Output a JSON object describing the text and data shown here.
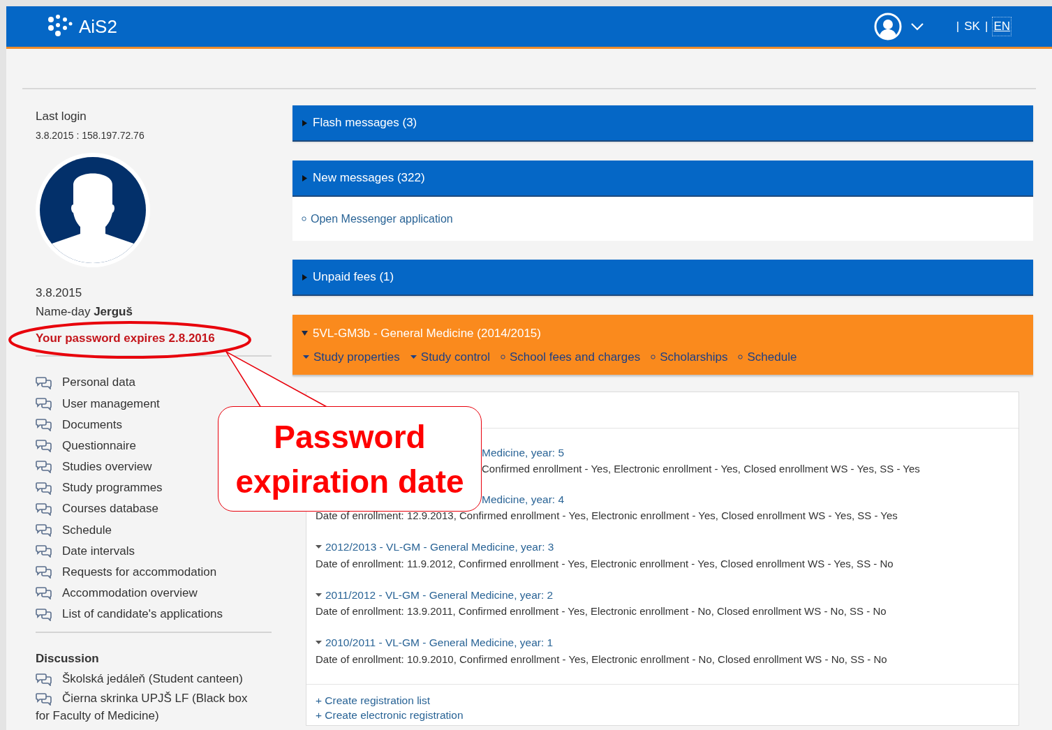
{
  "header": {
    "logo_text": "AiS2",
    "languages": [
      {
        "separator": "|",
        "label": "SK",
        "selected": false
      },
      {
        "separator": "|",
        "label": "EN",
        "selected": true
      }
    ]
  },
  "sidebar": {
    "last_login_label": "Last login",
    "last_login_value": "3.8.2015 : 158.197.72.76",
    "date": "3.8.2015",
    "name_day": "Name-day **Jerguš**",
    "password_warning": "Your password expires 2.8.2016",
    "menu": [
      "Personal data",
      "User management",
      "Documents",
      "Questionnaire",
      "Studies overview",
      "Study programmes",
      "Courses database",
      "Schedule",
      "Date intervals",
      "Requests for accommodation",
      "Accommodation overview",
      "List of candidate's applications"
    ],
    "discussion_title": "Discussion",
    "discussion": [
      "Školská jedáleň (Student canteen)",
      "Čierna skrinka UPJŠ LF (Black box for Faculty of Medicine)"
    ]
  },
  "panels": [
    {
      "title": "Flash messages (3)",
      "expanded": false,
      "selected": false
    },
    {
      "title": "New messages (322)",
      "expanded": false,
      "selected": false,
      "links": [
        {
          "kind": "bullet",
          "label": "Open Messenger application"
        }
      ]
    },
    {
      "title": "Unpaid fees (1)",
      "expanded": false,
      "selected": false
    },
    {
      "title": "5VL-GM3b - General Medicine (2014/2015)",
      "expanded": true,
      "selected": true,
      "links": [
        {
          "kind": "dropdown",
          "label": "Study properties"
        },
        {
          "kind": "dropdown",
          "label": "Study control"
        },
        {
          "kind": "bullet",
          "label": "School fees and charges"
        },
        {
          "kind": "bullet",
          "label": "Scholarships"
        },
        {
          "kind": "bullet",
          "label": "Schedule"
        }
      ]
    }
  ],
  "studies": [
    {
      "title": "Medicine, year: 5",
      "details": "Confirmed enrollment - Yes, Electronic enrollment - Yes, Closed enrollment WS - Yes, SS - Yes",
      "kind": "both_covered"
    },
    {
      "title": "Medicine, year: 4",
      "details": "Date of enrollment: 12.9.2013, Confirmed enrollment - Yes, Electronic enrollment - Yes, Closed enrollment WS - Yes, SS - Yes",
      "kind": "title_covered"
    },
    {
      "title": "2012/2013 - VL-GM - General Medicine, year: 3",
      "details": "Date of enrollment: 11.9.2012, Confirmed enrollment - Yes, Electronic enrollment - Yes, Closed enrollment WS - Yes, SS - No",
      "kind": "plain"
    },
    {
      "title": "2011/2012 - VL-GM - General Medicine, year: 2",
      "details": "Date of enrollment: 13.9.2011, Confirmed enrollment - Yes, Electronic enrollment - No, Closed enrollment WS - No, SS - No",
      "kind": "plain"
    },
    {
      "title": "2010/2011 - VL-GM - General Medicine, year: 1",
      "details": "Date of enrollment: 10.9.2010, Confirmed enrollment - Yes, Electronic enrollment - No, Closed enrollment WS - No, SS - No",
      "kind": "plain"
    }
  ],
  "actions": [
    "+ Create registration list",
    "+ Create electronic registration"
  ],
  "callout": {
    "text": "Password expiration date"
  }
}
